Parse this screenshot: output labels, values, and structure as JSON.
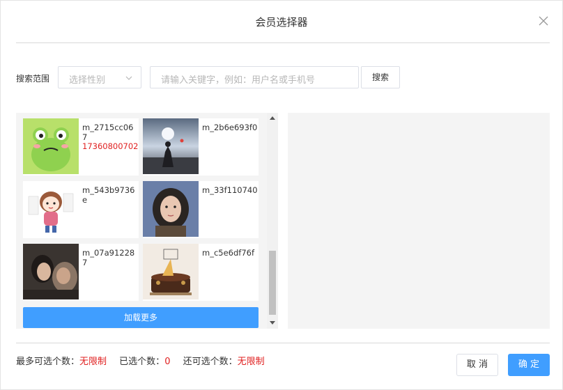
{
  "dialog": {
    "title": "会员选择器"
  },
  "search": {
    "label": "搜索范围",
    "gender_placeholder": "选择性别",
    "keyword_placeholder": "请输入关键字，例如：用户名或手机号",
    "button_label": "搜索"
  },
  "members": [
    {
      "name": "m_2715cc067",
      "phone": "17360800702",
      "avatar": "frog-avatar"
    },
    {
      "name": "m_2b6e693f0",
      "phone": "",
      "avatar": "beach-photo-avatar"
    },
    {
      "name": "m_543b9736e",
      "phone": "",
      "avatar": "cartoon-girl-avatar"
    },
    {
      "name": "m_33f110740",
      "phone": "",
      "avatar": "girl-selfie-avatar"
    },
    {
      "name": "m_07a912287",
      "phone": "",
      "avatar": "couple-photo-avatar"
    },
    {
      "name": "m_c5e6df76f",
      "phone": "",
      "avatar": "birthday-cake-avatar"
    }
  ],
  "load_more_label": "加载更多",
  "footer": {
    "max_label": "最多可选个数：",
    "max_value": "无限制",
    "selected_label": "已选个数：",
    "selected_value": "0",
    "remaining_label": "还可选个数：",
    "remaining_value": "无限制",
    "cancel_label": "取 消",
    "ok_label": "确 定"
  },
  "colors": {
    "accent": "#409eff",
    "highlight": "#e02020"
  }
}
